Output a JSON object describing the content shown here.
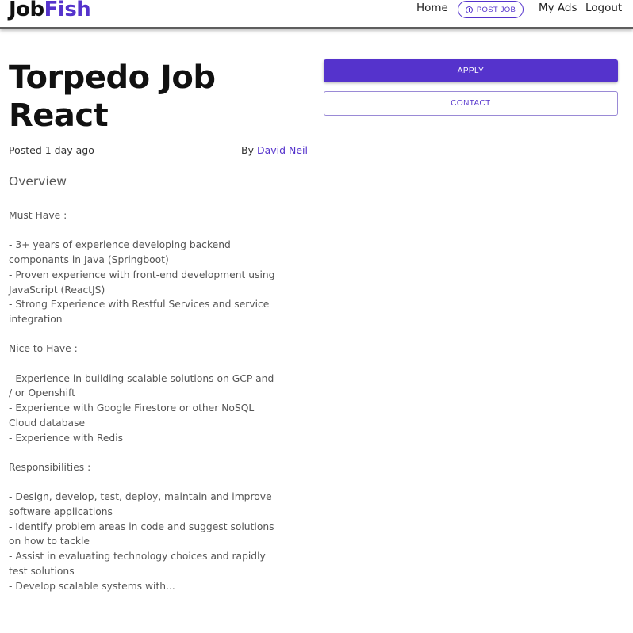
{
  "brand": {
    "logo_part1": "Job",
    "logo_part2": "Fish",
    "accent_color": "#5533cc"
  },
  "nav": {
    "home": "Home",
    "post_job": "POST JOB",
    "post_job_icon": "plus-circle-icon",
    "my_ads": "My Ads",
    "logout": "Logout"
  },
  "job": {
    "title": "Torpedo Job React",
    "posted": "Posted 1 day ago",
    "by_prefix": "By ",
    "author": "David Neil",
    "overview_heading": "Overview",
    "description_lines": [
      "Must Have :",
      "",
      "- 3+ years of experience developing backend componants in Java (Springboot)",
      "- Proven experience with front-end development using JavaScript (ReactJS)",
      "- Strong Experience with Restful Services and service integration",
      "",
      "Nice to Have :",
      "",
      "- Experience in building scalable solutions on GCP and / or Openshift",
      "- Experience with Google Firestore or other NoSQL Cloud database",
      "- Experience with Redis",
      "",
      "Responsibilities :",
      "",
      "- Design, develop, test, deploy, maintain and improve software applications",
      "- Identify problem areas in code and suggest solutions on how to tackle",
      "- Assist in evaluating technology choices and rapidly test solutions",
      "- Develop scalable systems with..."
    ]
  },
  "actions": {
    "apply": "APPLY",
    "contact": "CONTACT"
  }
}
